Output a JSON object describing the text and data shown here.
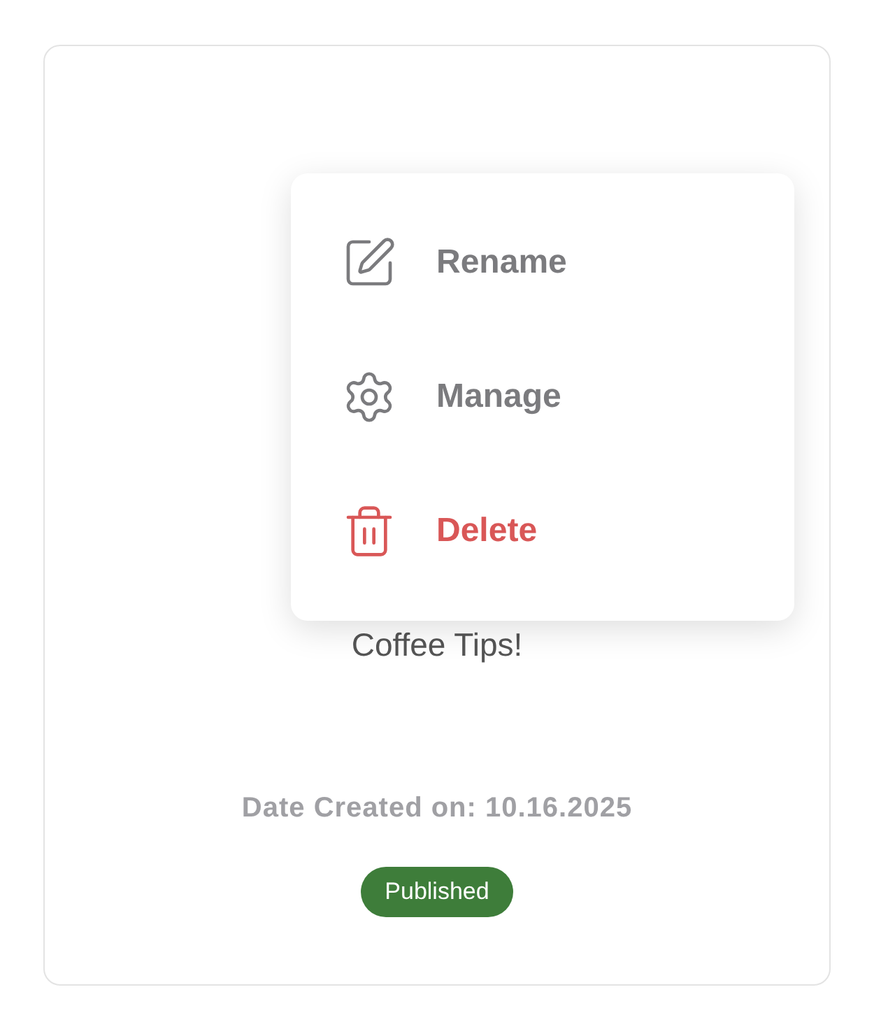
{
  "card": {
    "title": "Coffee Tips!",
    "date_created": "Date Created on: 10.16.2025",
    "status": "Published"
  },
  "menu": {
    "items": [
      {
        "label": "Rename",
        "kind": "rename"
      },
      {
        "label": "Manage",
        "kind": "manage"
      },
      {
        "label": "Delete",
        "kind": "delete"
      }
    ]
  }
}
